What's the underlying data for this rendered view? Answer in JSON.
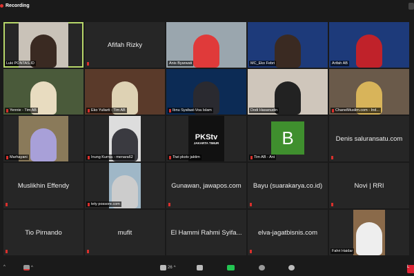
{
  "topbar": {
    "recording_label": "Recording",
    "recording_color": "#e0312e"
  },
  "participants": [
    {
      "name": "Luki PONTAS.ID",
      "video": true,
      "active": true,
      "muted": false
    },
    {
      "name": "Afifah Rizky",
      "video": false,
      "muted": true
    },
    {
      "name": "Anis Byarwati",
      "video": true,
      "muted": false
    },
    {
      "name": "MC_Eko Febri",
      "video": true,
      "muted": false
    },
    {
      "name": "Arifah AB",
      "video": true,
      "muted": false
    },
    {
      "name": "Yennie - Tim AB",
      "video": true,
      "muted": true
    },
    {
      "name": "Eko Yuliarti - Tim AB",
      "video": true,
      "muted": true
    },
    {
      "name": "Ibnu Syafaat-Voa Islam",
      "video": true,
      "muted": true
    },
    {
      "name": "Dodi Hasanudin",
      "video": true,
      "muted": false
    },
    {
      "name": "ChanelMuslim.com - Ind...",
      "video": true,
      "muted": true
    },
    {
      "name": "Marhayani",
      "video": true,
      "muted": true
    },
    {
      "name": "Inung Kurnia - menara62",
      "video": true,
      "muted": true
    },
    {
      "name": "Tiwi pkstv jaktim",
      "video": true,
      "muted": true,
      "logo": "PKStv",
      "logo_sub": "JAKARTA TIMUR"
    },
    {
      "name": "Tim AB - Ani",
      "video": true,
      "muted": true,
      "avatar_letter": "B",
      "avatar_color": "#3f8f2e"
    },
    {
      "name": "Denis saluransatu.com",
      "video": false,
      "muted": true
    },
    {
      "name": "Muslikhin Effendy",
      "video": false,
      "muted": true
    },
    {
      "name": "tety possore.com",
      "video": true,
      "muted": true
    },
    {
      "name": "Gunawan, jawapos.com",
      "video": false,
      "muted": true
    },
    {
      "name": "Bayu (suarakarya.co.id)",
      "video": false,
      "muted": true
    },
    {
      "name": "Novi | RRI",
      "video": false,
      "muted": true
    },
    {
      "name": "Tio Pirnando",
      "video": false,
      "muted": true
    },
    {
      "name": "mufit",
      "video": false,
      "muted": true
    },
    {
      "name": "El Hammi Rahmi Syifa...",
      "video": false,
      "muted": false
    },
    {
      "name": "elva-jagatbisnis.com",
      "video": false,
      "muted": true
    },
    {
      "name": "Fahri Haidar",
      "video": true,
      "muted": false
    }
  ],
  "toolbar": {
    "participants_count": "26",
    "leave_label": "L"
  }
}
